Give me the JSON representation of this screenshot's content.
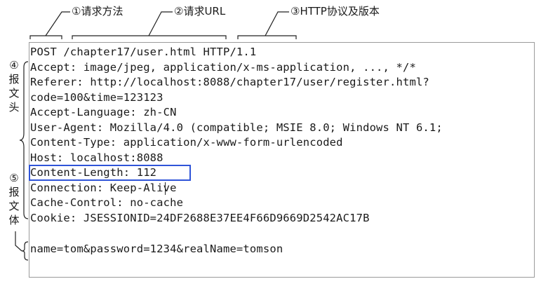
{
  "callouts": {
    "method": "①请求方法",
    "url": "②请求URL",
    "protocol": "③HTTP协议及版本",
    "header_num": "④",
    "header_chars": [
      "报",
      "文",
      "头"
    ],
    "body_num": "⑤",
    "body_chars": [
      "报",
      "文",
      "体"
    ]
  },
  "request": {
    "request_line": "POST /chapter17/user.html HTTP/1.1",
    "headers": [
      "Accept: image/jpeg, application/x-ms-application, ..., */*",
      "Referer: http://localhost:8088/chapter17/user/register.html?",
      "code=100&time=123123",
      "Accept-Language: zh-CN",
      "User-Agent: Mozilla/4.0 (compatible; MSIE 8.0; Windows NT 6.1;",
      "Content-Type: application/x-www-form-urlencoded",
      "Host: localhost:8088",
      "Content-Length: 112",
      "Connection: Keep-Alive",
      "Cache-Control: no-cache",
      "Cookie: JSESSIONID=24DF2688E37EE4F66D9669D2542AC17B"
    ],
    "body": "name=tom&password=1234&realName=tomson"
  },
  "colors": {
    "highlight": "#2f54d8",
    "text": "#1a1a1a",
    "border": "#9a9a9a"
  }
}
